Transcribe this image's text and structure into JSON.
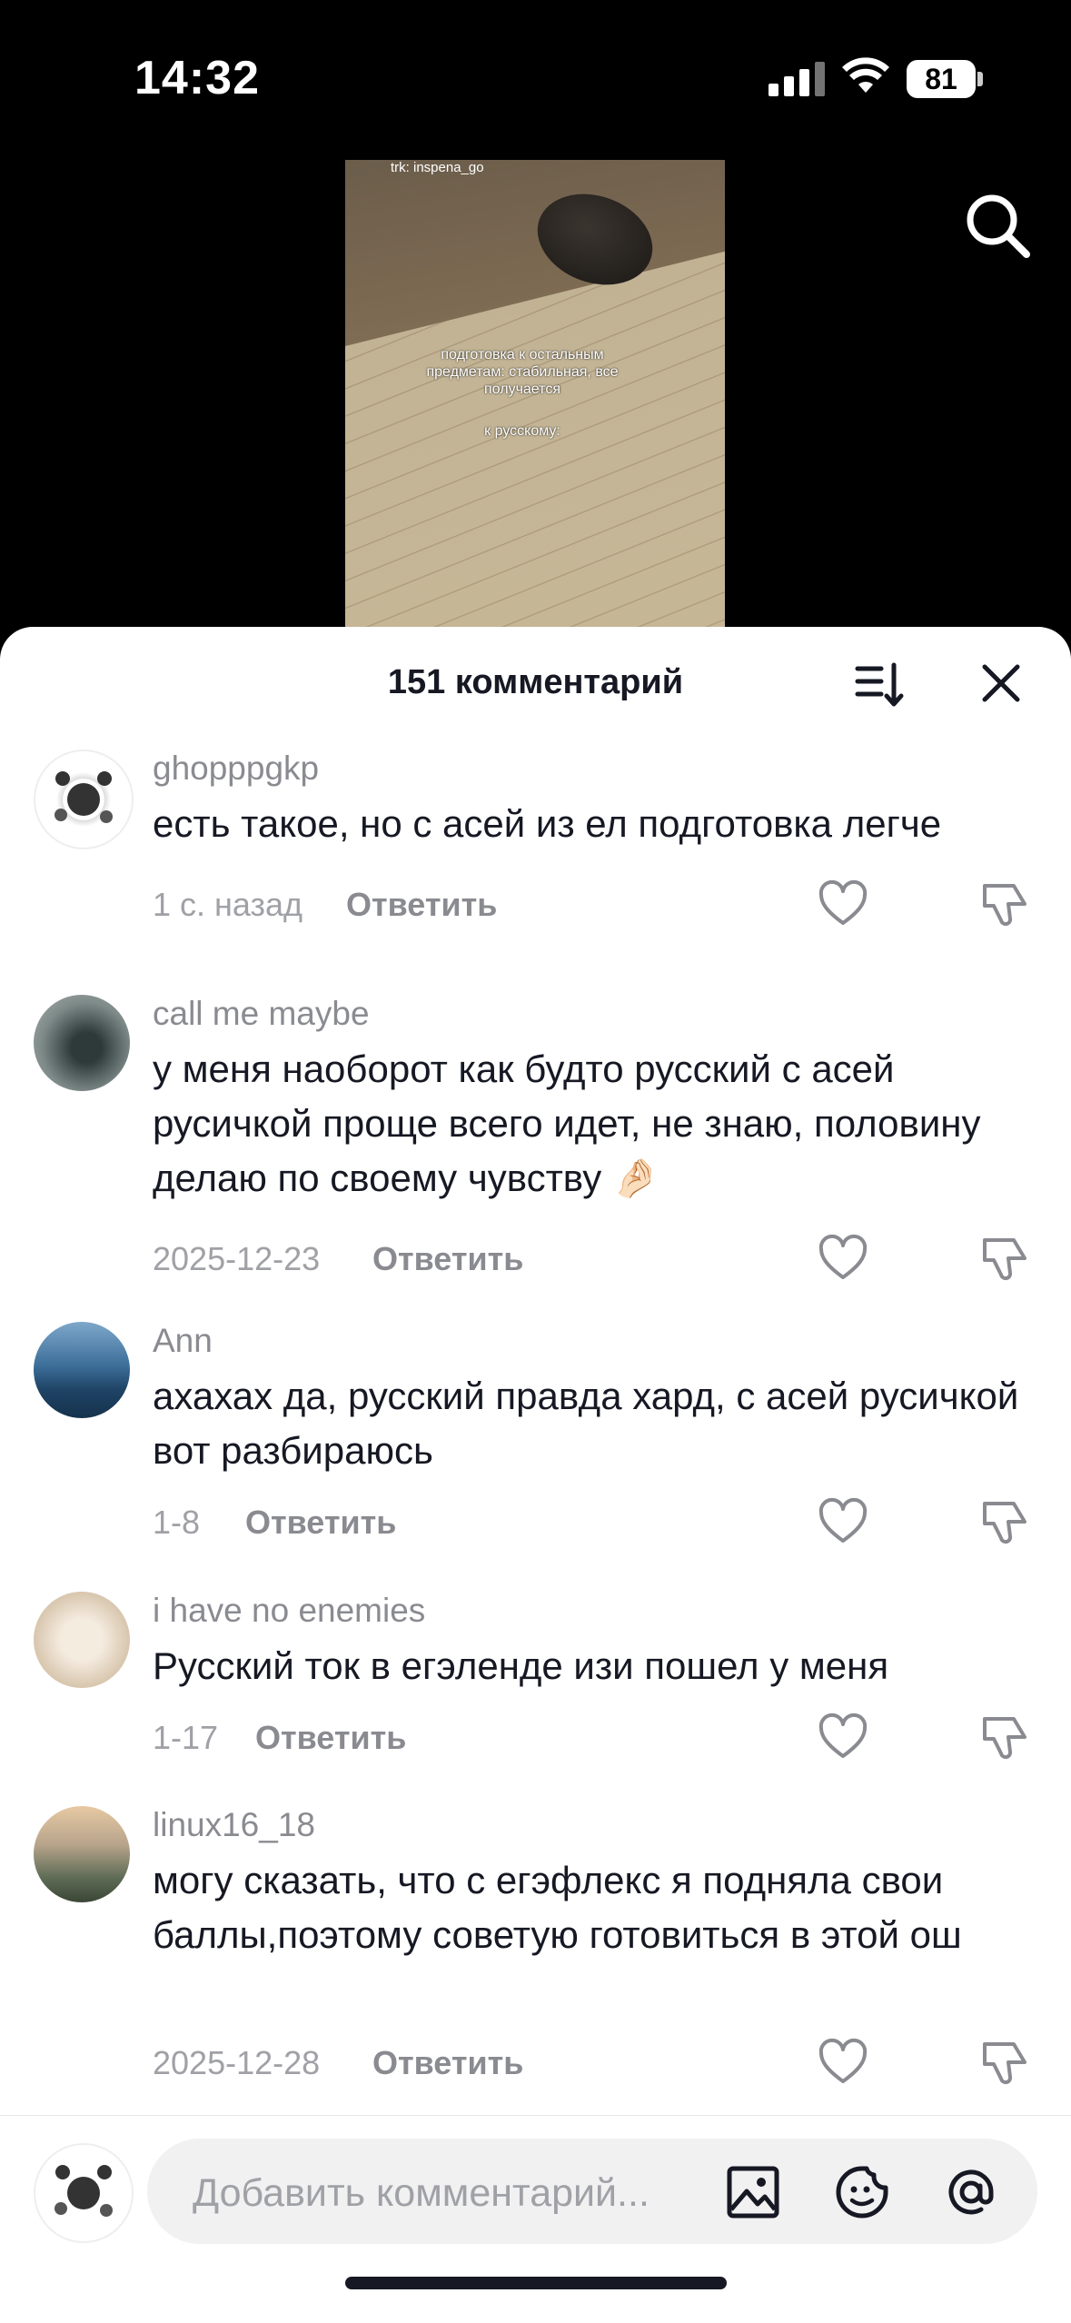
{
  "status_bar": {
    "time": "14:32",
    "battery": "81"
  },
  "video": {
    "handle": "trk: inspena_go",
    "caption_lines": "подготовка к остальным предметам: стабильная, все получается",
    "caption_second": "к русскому:"
  },
  "comments_header": {
    "title": "151 комментарий"
  },
  "comments": [
    {
      "username": "ghopppgkp",
      "text": "есть такое, но с асей из ел подготовка легче",
      "date": "1 с. назад",
      "reply": "Ответить"
    },
    {
      "username": "call me maybe",
      "text": "у меня наоборот как будто русский с асей русичкой проще всего идет, не знаю, половину делаю по своему чувству 🤌🏻",
      "date": "2025-12-23",
      "reply": "Ответить"
    },
    {
      "username": "Ann",
      "text": "ахахах да, русский правда хард, с асей русичкой вот разбираюсь",
      "date": "1-8",
      "reply": "Ответить"
    },
    {
      "username": "i have no enemies",
      "text": "Русский ток в егэленде изи пошел у меня",
      "date": "1-17",
      "reply": "Ответить"
    },
    {
      "username": "linux16_18",
      "text": "могу сказать, что с егэфлекс я подняла свои баллы,поэтому советую готовиться в этой ош",
      "date": "2025-12-28",
      "reply": "Ответить"
    }
  ],
  "input": {
    "placeholder": "Добавить комментарий..."
  },
  "colors": {
    "accent_text": "#161823",
    "muted": "#8a8b91",
    "input_bg": "#f1f1f2"
  }
}
